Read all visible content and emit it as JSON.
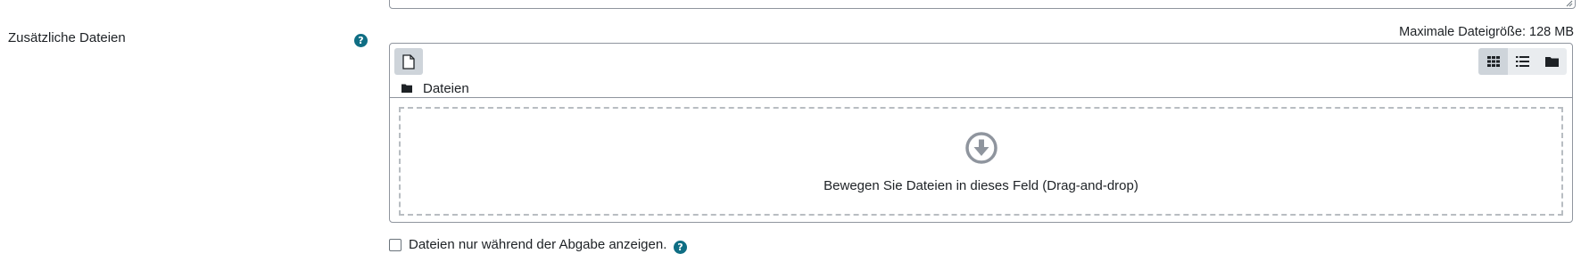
{
  "field": {
    "label": "Zusätzliche Dateien",
    "help_icon": "question-circle-icon"
  },
  "filemanager": {
    "max_size_text": "Maximale Dateigröße: 128 MB",
    "add_file_icon": "file-icon",
    "view_modes": [
      {
        "icon": "grid-icon",
        "active": true
      },
      {
        "icon": "list-icon",
        "active": false
      },
      {
        "icon": "folder-icon",
        "active": false
      }
    ],
    "breadcrumb_label": "Dateien",
    "breadcrumb_icon": "folder-icon",
    "dropzone_icon": "download-arrow-circle-icon",
    "dropzone_text": "Bewegen Sie Dateien in dieses Feld (Drag-and-drop)"
  },
  "checkbox": {
    "label": "Dateien nur während der Abgabe anzeigen.",
    "checked": false,
    "help_icon": "question-circle-icon"
  },
  "colors": {
    "help_icon": "#0f6e84",
    "border": "#8f959e",
    "toolbar_active": "#ced4da",
    "dropzone_border": "#b8bdc2",
    "drop_icon": "#8f959e"
  }
}
